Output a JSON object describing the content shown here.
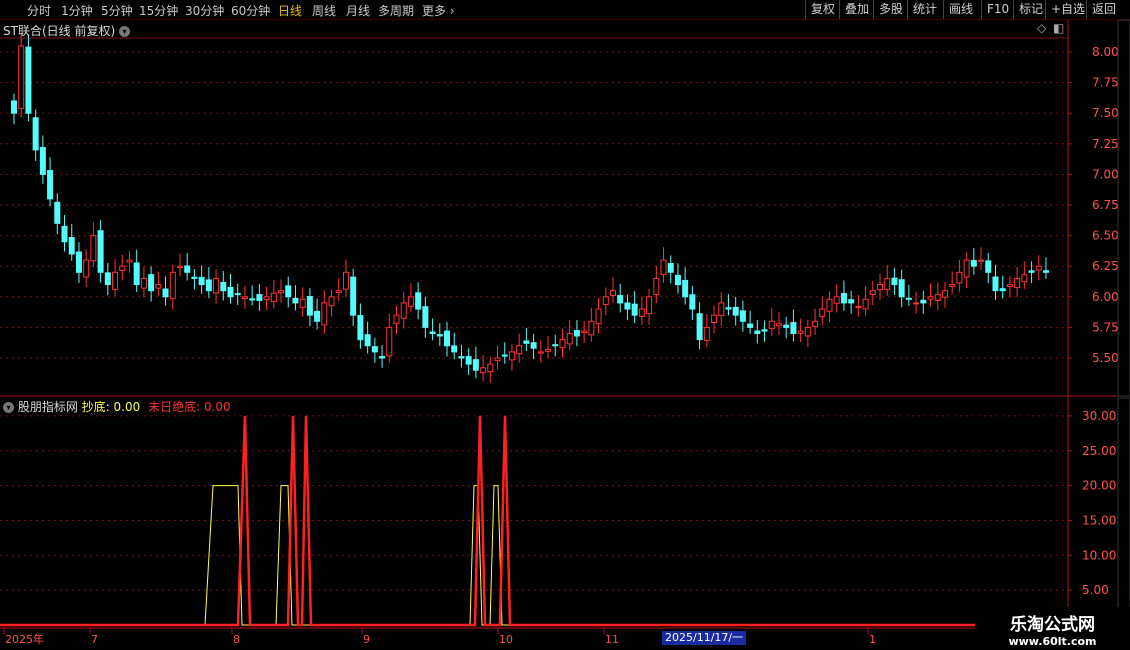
{
  "tabs": [
    "分时",
    "1分钟",
    "5分钟",
    "15分钟",
    "30分钟",
    "60分钟",
    "日线",
    "周线",
    "月线",
    "多周期",
    "更多"
  ],
  "active_tab": "日线",
  "right_buttons": [
    "复权",
    "叠加",
    "多股",
    "统计",
    "画线",
    "F10",
    "标记",
    "+自选",
    "返回"
  ],
  "main_title": "ST联合(日线 前复权)",
  "price_axis": [
    "8.00",
    "7.75",
    "7.50",
    "7.25",
    "7.00",
    "6.75",
    "6.50",
    "6.25",
    "6.00",
    "5.75",
    "5.50"
  ],
  "indicator": {
    "name": "股朋指标网",
    "line1_label": "抄底:",
    "line1_value": "0.00",
    "line2_label": "末日绝底:",
    "line2_value": "0.00"
  },
  "indicator_axis": [
    "30.00",
    "25.00",
    "20.00",
    "15.00",
    "10.00",
    "5.00"
  ],
  "date_axis": [
    "2025年",
    "7",
    "8",
    "9",
    "10",
    "11",
    "1"
  ],
  "cursor_date": "2025/11/17/一",
  "watermark": {
    "title": "乐淘公式网",
    "url": "www.60lt.com"
  },
  "colors": {
    "up": "#ff3232",
    "down": "#54fcfc",
    "line1": "#ffff54",
    "line2": "#ff2020",
    "grid": "#7a1010"
  }
}
